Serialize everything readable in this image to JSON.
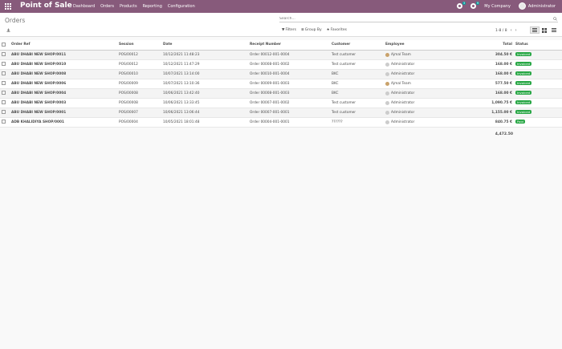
{
  "topbar": {
    "app_title": "Point of Sale",
    "menu": [
      "Dashboard",
      "Orders",
      "Products",
      "Reporting",
      "Configuration"
    ],
    "activity_count": "3",
    "message_count": "9",
    "company": "My Company",
    "user": "Administrator"
  },
  "control_panel": {
    "breadcrumb": "Orders",
    "search_placeholder": "Search...",
    "filters_label": "Filters",
    "group_by_label": "Group By",
    "favorites_label": "Favorites",
    "pager": "1-8 / 8"
  },
  "table": {
    "headers": {
      "order_ref": "Order Ref",
      "session": "Session",
      "date": "Date",
      "receipt": "Receipt Number",
      "customer": "Customer",
      "employee": "Employee",
      "total": "Total",
      "status": "Status"
    },
    "rows": [
      {
        "order_ref": "ABU DHABI NEW SHOP/0011",
        "session": "POS/00012",
        "date": "10/12/2021 11:48:23",
        "receipt": "Order 00012-001-0004",
        "customer": "Test customer",
        "employee": "Ajmal Team",
        "total": "304.50 €",
        "status": "Invoiced"
      },
      {
        "order_ref": "ABU DHABI NEW SHOP/0010",
        "session": "POS/00012",
        "date": "10/12/2021 11:47:29",
        "receipt": "Order 00008-001-0002",
        "customer": "Test customer",
        "employee": "Administrator",
        "total": "168.00 €",
        "status": "Invoiced"
      },
      {
        "order_ref": "ABU DHABI NEW SHOP/0008",
        "session": "POS/00010",
        "date": "10/07/2021 13:14:00",
        "receipt": "Order 00010-001-0004",
        "customer": "BKC",
        "employee": "Administrator",
        "total": "168.00 €",
        "status": "Invoiced"
      },
      {
        "order_ref": "ABU DHABI NEW SHOP/0006",
        "session": "POS/00009",
        "date": "10/07/2021 13:10:36",
        "receipt": "Order 00009-001-0003",
        "customer": "BKC",
        "employee": "Ajmal Team",
        "total": "577.50 €",
        "status": "Invoiced"
      },
      {
        "order_ref": "ABU DHABI NEW SHOP/0004",
        "session": "POS/00008",
        "date": "10/06/2021 13:42:40",
        "receipt": "Order 00008-001-0003",
        "customer": "BKC",
        "employee": "Administrator",
        "total": "168.00 €",
        "status": "Invoiced"
      },
      {
        "order_ref": "ABU DHABI NEW SHOP/0003",
        "session": "POS/00008",
        "date": "10/06/2021 13:33:45",
        "receipt": "Order 00007-001-0002",
        "customer": "Test customer",
        "employee": "Administrator",
        "total": "1,090.75 €",
        "status": "Invoiced"
      },
      {
        "order_ref": "ABU DHABI NEW SHOP/0001",
        "session": "POS/00007",
        "date": "10/06/2021 13:06:44",
        "receipt": "Order 00007-001-0001",
        "customer": "Test customer",
        "employee": "Administrator",
        "total": "1,155.00 €",
        "status": "Invoiced"
      },
      {
        "order_ref": "ADB KHALIDIYA SHOP/0001",
        "session": "POS/00004",
        "date": "10/05/2021 18:01:48",
        "receipt": "Order 00004-001-0001",
        "customer": "??????",
        "employee": "Administrator",
        "total": "840.75 €",
        "status": "Paid"
      }
    ],
    "sum_total": "4,472.50"
  },
  "colors": {
    "brand": "#875a7b",
    "invoiced": "#28a745",
    "paid": "#28a745"
  }
}
